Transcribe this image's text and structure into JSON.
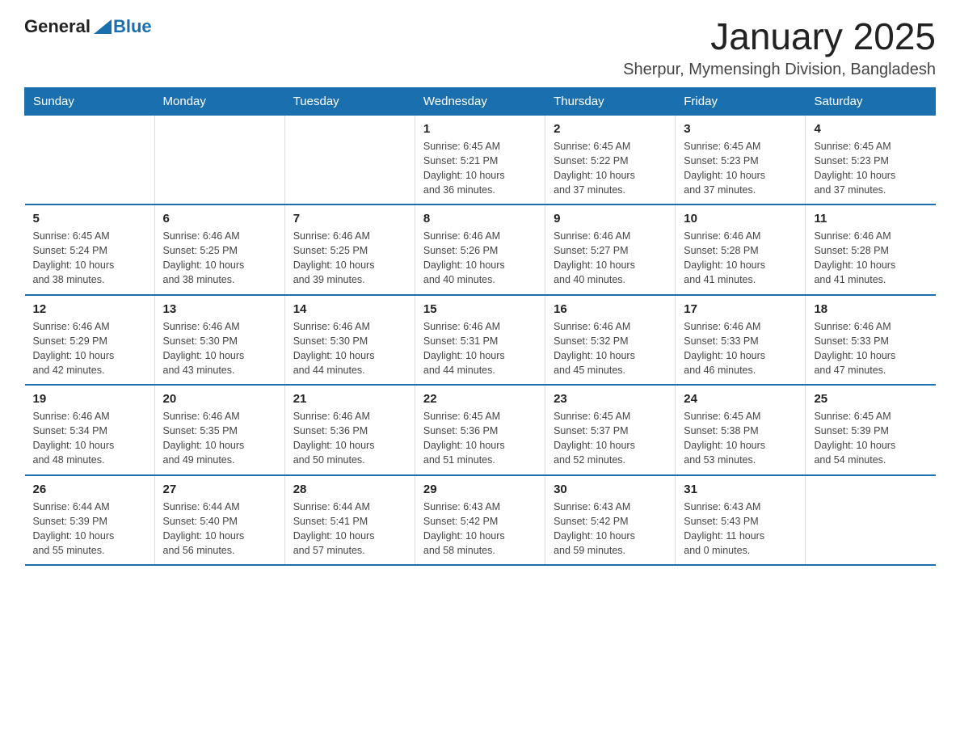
{
  "header": {
    "logo_general": "General",
    "logo_blue": "Blue",
    "title": "January 2025",
    "subtitle": "Sherpur, Mymensingh Division, Bangladesh"
  },
  "days_of_week": [
    "Sunday",
    "Monday",
    "Tuesday",
    "Wednesday",
    "Thursday",
    "Friday",
    "Saturday"
  ],
  "weeks": [
    [
      {
        "day": "",
        "info": ""
      },
      {
        "day": "",
        "info": ""
      },
      {
        "day": "",
        "info": ""
      },
      {
        "day": "1",
        "info": "Sunrise: 6:45 AM\nSunset: 5:21 PM\nDaylight: 10 hours\nand 36 minutes."
      },
      {
        "day": "2",
        "info": "Sunrise: 6:45 AM\nSunset: 5:22 PM\nDaylight: 10 hours\nand 37 minutes."
      },
      {
        "day": "3",
        "info": "Sunrise: 6:45 AM\nSunset: 5:23 PM\nDaylight: 10 hours\nand 37 minutes."
      },
      {
        "day": "4",
        "info": "Sunrise: 6:45 AM\nSunset: 5:23 PM\nDaylight: 10 hours\nand 37 minutes."
      }
    ],
    [
      {
        "day": "5",
        "info": "Sunrise: 6:45 AM\nSunset: 5:24 PM\nDaylight: 10 hours\nand 38 minutes."
      },
      {
        "day": "6",
        "info": "Sunrise: 6:46 AM\nSunset: 5:25 PM\nDaylight: 10 hours\nand 38 minutes."
      },
      {
        "day": "7",
        "info": "Sunrise: 6:46 AM\nSunset: 5:25 PM\nDaylight: 10 hours\nand 39 minutes."
      },
      {
        "day": "8",
        "info": "Sunrise: 6:46 AM\nSunset: 5:26 PM\nDaylight: 10 hours\nand 40 minutes."
      },
      {
        "day": "9",
        "info": "Sunrise: 6:46 AM\nSunset: 5:27 PM\nDaylight: 10 hours\nand 40 minutes."
      },
      {
        "day": "10",
        "info": "Sunrise: 6:46 AM\nSunset: 5:28 PM\nDaylight: 10 hours\nand 41 minutes."
      },
      {
        "day": "11",
        "info": "Sunrise: 6:46 AM\nSunset: 5:28 PM\nDaylight: 10 hours\nand 41 minutes."
      }
    ],
    [
      {
        "day": "12",
        "info": "Sunrise: 6:46 AM\nSunset: 5:29 PM\nDaylight: 10 hours\nand 42 minutes."
      },
      {
        "day": "13",
        "info": "Sunrise: 6:46 AM\nSunset: 5:30 PM\nDaylight: 10 hours\nand 43 minutes."
      },
      {
        "day": "14",
        "info": "Sunrise: 6:46 AM\nSunset: 5:30 PM\nDaylight: 10 hours\nand 44 minutes."
      },
      {
        "day": "15",
        "info": "Sunrise: 6:46 AM\nSunset: 5:31 PM\nDaylight: 10 hours\nand 44 minutes."
      },
      {
        "day": "16",
        "info": "Sunrise: 6:46 AM\nSunset: 5:32 PM\nDaylight: 10 hours\nand 45 minutes."
      },
      {
        "day": "17",
        "info": "Sunrise: 6:46 AM\nSunset: 5:33 PM\nDaylight: 10 hours\nand 46 minutes."
      },
      {
        "day": "18",
        "info": "Sunrise: 6:46 AM\nSunset: 5:33 PM\nDaylight: 10 hours\nand 47 minutes."
      }
    ],
    [
      {
        "day": "19",
        "info": "Sunrise: 6:46 AM\nSunset: 5:34 PM\nDaylight: 10 hours\nand 48 minutes."
      },
      {
        "day": "20",
        "info": "Sunrise: 6:46 AM\nSunset: 5:35 PM\nDaylight: 10 hours\nand 49 minutes."
      },
      {
        "day": "21",
        "info": "Sunrise: 6:46 AM\nSunset: 5:36 PM\nDaylight: 10 hours\nand 50 minutes."
      },
      {
        "day": "22",
        "info": "Sunrise: 6:45 AM\nSunset: 5:36 PM\nDaylight: 10 hours\nand 51 minutes."
      },
      {
        "day": "23",
        "info": "Sunrise: 6:45 AM\nSunset: 5:37 PM\nDaylight: 10 hours\nand 52 minutes."
      },
      {
        "day": "24",
        "info": "Sunrise: 6:45 AM\nSunset: 5:38 PM\nDaylight: 10 hours\nand 53 minutes."
      },
      {
        "day": "25",
        "info": "Sunrise: 6:45 AM\nSunset: 5:39 PM\nDaylight: 10 hours\nand 54 minutes."
      }
    ],
    [
      {
        "day": "26",
        "info": "Sunrise: 6:44 AM\nSunset: 5:39 PM\nDaylight: 10 hours\nand 55 minutes."
      },
      {
        "day": "27",
        "info": "Sunrise: 6:44 AM\nSunset: 5:40 PM\nDaylight: 10 hours\nand 56 minutes."
      },
      {
        "day": "28",
        "info": "Sunrise: 6:44 AM\nSunset: 5:41 PM\nDaylight: 10 hours\nand 57 minutes."
      },
      {
        "day": "29",
        "info": "Sunrise: 6:43 AM\nSunset: 5:42 PM\nDaylight: 10 hours\nand 58 minutes."
      },
      {
        "day": "30",
        "info": "Sunrise: 6:43 AM\nSunset: 5:42 PM\nDaylight: 10 hours\nand 59 minutes."
      },
      {
        "day": "31",
        "info": "Sunrise: 6:43 AM\nSunset: 5:43 PM\nDaylight: 11 hours\nand 0 minutes."
      },
      {
        "day": "",
        "info": ""
      }
    ]
  ]
}
